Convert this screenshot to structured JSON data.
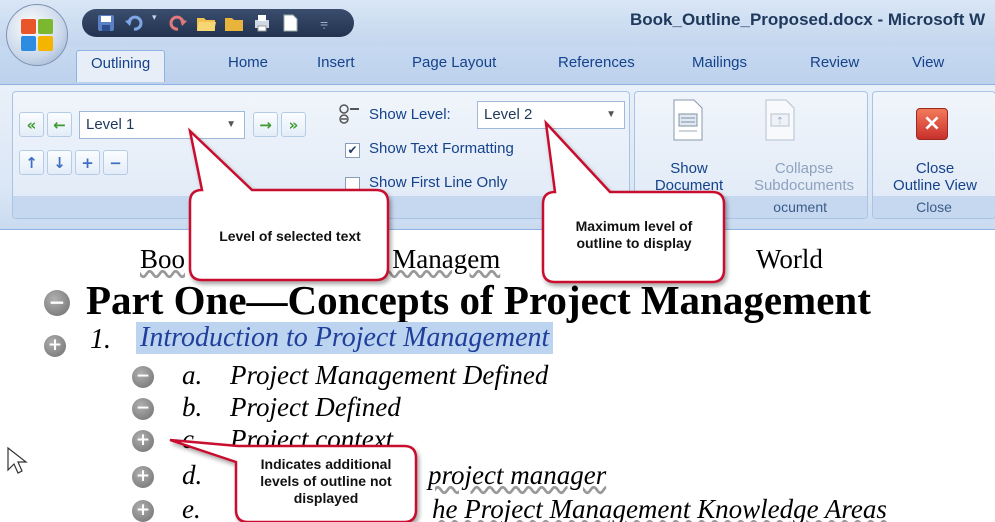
{
  "window": {
    "title": "Book_Outline_Proposed.docx - Microsoft W"
  },
  "tabs": [
    "Outlining",
    "Home",
    "Insert",
    "Page Layout",
    "References",
    "Mailings",
    "Review",
    "View"
  ],
  "outline_tools": {
    "level_value": "Level 1",
    "show_level_label": "Show Level:",
    "show_level_value": "Level 2",
    "show_text_formatting_label": "Show Text Formatting",
    "show_text_formatting_checked": true,
    "show_first_line_label": "Show First Line Only",
    "show_first_line_checked": false
  },
  "master_document": {
    "show_document_line1": "Show",
    "show_document_line2": "Document",
    "collapse_line1": "Collapse",
    "collapse_line2": "Subdocuments",
    "group_label_partial": "ocument"
  },
  "close_group": {
    "close_line1": "Close",
    "close_line2": "Outline View",
    "group_label": "Close"
  },
  "document": {
    "title_left": "Boo",
    "title_mid": "t Managem",
    "title_right": "World",
    "part_heading": "Part One—Concepts of Project Management",
    "chapter_number": "1.",
    "chapter_title": "Introduction to Project Management",
    "items": [
      {
        "letter": "a.",
        "text": "Project Management Defined"
      },
      {
        "letter": "b.",
        "text": "Project  Defined"
      },
      {
        "letter": "c.",
        "text": "Project context"
      },
      {
        "letter": "d.",
        "text": "project manager"
      },
      {
        "letter": "e.",
        "text": "he Project Management Knowledge Areas"
      }
    ]
  },
  "callouts": {
    "level_selected": "Level of selected text",
    "max_level_line1": "Maximum level of",
    "max_level_line2": "outline to display",
    "indicates_line1": "Indicates additional",
    "indicates_line2": "levels of outline not",
    "indicates_line3": "displayed"
  },
  "colors": {
    "ribbon_text": "#15428b",
    "callout_border": "#c8102e",
    "selection_highlight": "#bcd4f0"
  }
}
